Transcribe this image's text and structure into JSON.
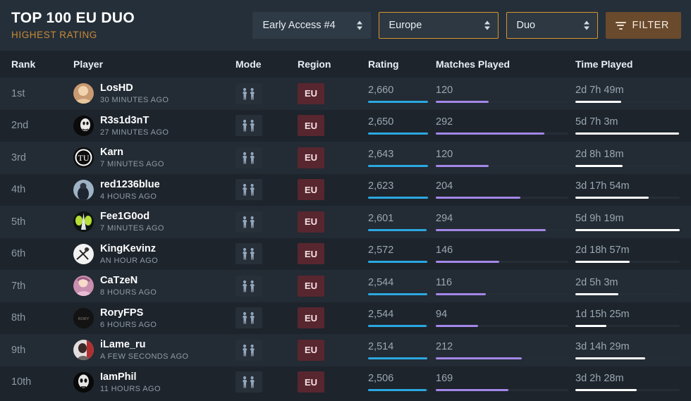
{
  "header": {
    "title": "TOP 100 EU DUO",
    "subtitle": "HIGHEST RATING",
    "season_select": "Early Access #4",
    "region_select": "Europe",
    "mode_select": "Duo",
    "filter_label": "FILTER",
    "accent_color": "#d8952f",
    "subtitle_color": "#c98a36"
  },
  "columns": {
    "rank": "Rank",
    "player": "Player",
    "mode": "Mode",
    "region": "Region",
    "rating": "Rating",
    "matches": "Matches Played",
    "time": "Time Played"
  },
  "bar_colors": {
    "rating": "#2ba8e0",
    "matches": "#a387e8",
    "time": "#ffffff"
  },
  "rows": [
    {
      "rank": "1st",
      "name": "LosHD",
      "ago": "30 MINUTES AGO",
      "mode": "duo-icon",
      "region": "EU",
      "rating": "2,660",
      "rating_pct": 99,
      "matches": "120",
      "matches_pct": 40,
      "time": "2d 7h 49m",
      "time_pct": 44
    },
    {
      "rank": "2nd",
      "name": "R3s1d3nT",
      "ago": "27 MINUTES AGO",
      "mode": "duo-icon",
      "region": "EU",
      "rating": "2,650",
      "rating_pct": 99,
      "matches": "292",
      "matches_pct": 82,
      "time": "5d 7h 3m",
      "time_pct": 99
    },
    {
      "rank": "3rd",
      "name": "Karn",
      "ago": "7 MINUTES AGO",
      "mode": "duo-icon",
      "region": "EU",
      "rating": "2,643",
      "rating_pct": 99,
      "matches": "120",
      "matches_pct": 40,
      "time": "2d 8h 18m",
      "time_pct": 45
    },
    {
      "rank": "4th",
      "name": "red1236blue",
      "ago": "4 HOURS AGO",
      "mode": "duo-icon",
      "region": "EU",
      "rating": "2,623",
      "rating_pct": 99,
      "matches": "204",
      "matches_pct": 64,
      "time": "3d 17h 54m",
      "time_pct": 70
    },
    {
      "rank": "5th",
      "name": "Fee1G0od",
      "ago": "7 MINUTES AGO",
      "mode": "duo-icon",
      "region": "EU",
      "rating": "2,601",
      "rating_pct": 97,
      "matches": "294",
      "matches_pct": 83,
      "time": "5d 9h 19m",
      "time_pct": 100
    },
    {
      "rank": "6th",
      "name": "KingKevinz",
      "ago": "AN HOUR AGO",
      "mode": "duo-icon",
      "region": "EU",
      "rating": "2,572",
      "rating_pct": 98,
      "matches": "146",
      "matches_pct": 48,
      "time": "2d 18h 57m",
      "time_pct": 52
    },
    {
      "rank": "7th",
      "name": "CaTzeN",
      "ago": "8 HOURS AGO",
      "mode": "duo-icon",
      "region": "EU",
      "rating": "2,544",
      "rating_pct": 98,
      "matches": "116",
      "matches_pct": 38,
      "time": "2d 5h 3m",
      "time_pct": 41
    },
    {
      "rank": "8th",
      "name": "RoryFPS",
      "ago": "6 HOURS AGO",
      "mode": "duo-icon",
      "region": "EU",
      "rating": "2,544",
      "rating_pct": 97,
      "matches": "94",
      "matches_pct": 32,
      "time": "1d 15h 25m",
      "time_pct": 30
    },
    {
      "rank": "9th",
      "name": "iLame_ru",
      "ago": "A FEW SECONDS AGO",
      "mode": "duo-icon",
      "region": "EU",
      "rating": "2,514",
      "rating_pct": 98,
      "matches": "212",
      "matches_pct": 65,
      "time": "3d 14h 29m",
      "time_pct": 67
    },
    {
      "rank": "10th",
      "name": "IamPhil",
      "ago": "11 HOURS AGO",
      "mode": "duo-icon",
      "region": "EU",
      "rating": "2,506",
      "rating_pct": 96,
      "matches": "169",
      "matches_pct": 55,
      "time": "3d 2h 28m",
      "time_pct": 59
    }
  ]
}
